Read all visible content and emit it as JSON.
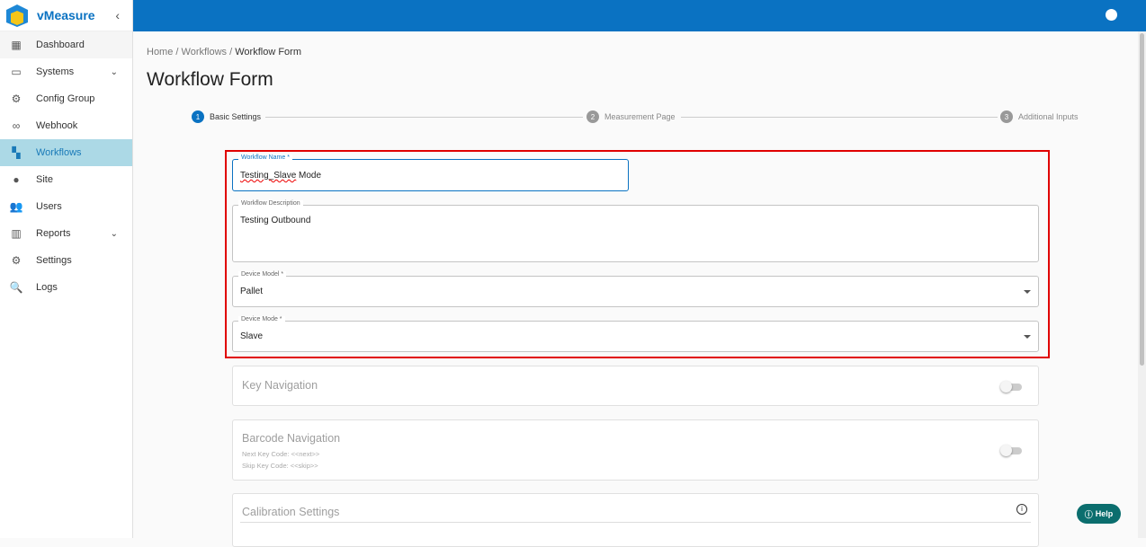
{
  "app": {
    "name": "vMeasure"
  },
  "sidebar": {
    "items": [
      {
        "label": "Dashboard",
        "icon": "dashboard-icon"
      },
      {
        "label": "Systems",
        "icon": "devices-icon"
      },
      {
        "label": "Config Group",
        "icon": "gears-icon"
      },
      {
        "label": "Webhook",
        "icon": "webhook-icon"
      },
      {
        "label": "Workflows",
        "icon": "workflow-icon"
      },
      {
        "label": "Site",
        "icon": "location-pin-icon"
      },
      {
        "label": "Users",
        "icon": "users-icon"
      },
      {
        "label": "Reports",
        "icon": "chart-icon"
      },
      {
        "label": "Settings",
        "icon": "gear-icon"
      },
      {
        "label": "Logs",
        "icon": "log-search-icon"
      }
    ]
  },
  "breadcrumb": {
    "home": "Home",
    "workflows": "Workflows",
    "current": "Workflow Form",
    "sep": "/"
  },
  "page_title": "Workflow Form",
  "steps": [
    {
      "num": "1",
      "label": "Basic Settings"
    },
    {
      "num": "2",
      "label": "Measurement Page"
    },
    {
      "num": "3",
      "label": "Additional Inputs"
    }
  ],
  "form": {
    "name": {
      "label": "Workflow Name *",
      "value_a": "Testing_Slave",
      "value_b": " Mode"
    },
    "description": {
      "label": "Workflow Description",
      "value": "Testing Outbound"
    },
    "device_model": {
      "label": "Device Model *",
      "value": "Pallet"
    },
    "device_mode": {
      "label": "Device Mode *",
      "value": "Slave"
    }
  },
  "sections": {
    "key_nav": "Key Navigation",
    "barcode_nav": "Barcode Navigation",
    "next_key": "Next Key Code: <<next>>",
    "skip_key": "Skip Key Code: <<skip>>",
    "calibration": "Calibration Settings"
  },
  "help": "Help",
  "colors": {
    "primary": "#0a72c2",
    "highlight": "#e00000"
  }
}
